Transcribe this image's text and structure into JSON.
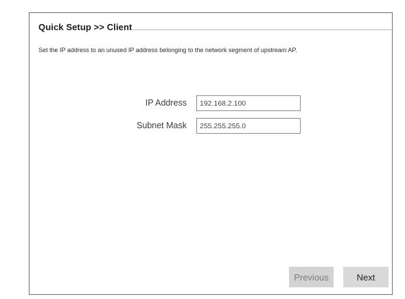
{
  "header": {
    "title": "Quick Setup >> Client"
  },
  "description": "Set the IP address to an unused IP address belonging to the network segment of upstream AP.",
  "form": {
    "ip_address": {
      "label": "IP Address",
      "value": "192.168.2.100"
    },
    "subnet_mask": {
      "label": "Subnet Mask",
      "value": "255.255.255.0"
    }
  },
  "buttons": {
    "previous_label": "Previous",
    "next_label": "Next"
  },
  "colors": {
    "frame_border": "#6e6e6e",
    "previous_bg": "#d3d3d3",
    "previous_text": "#7a7a7a",
    "next_bg": "#d9d9d9",
    "next_text": "#1f1f1f"
  }
}
